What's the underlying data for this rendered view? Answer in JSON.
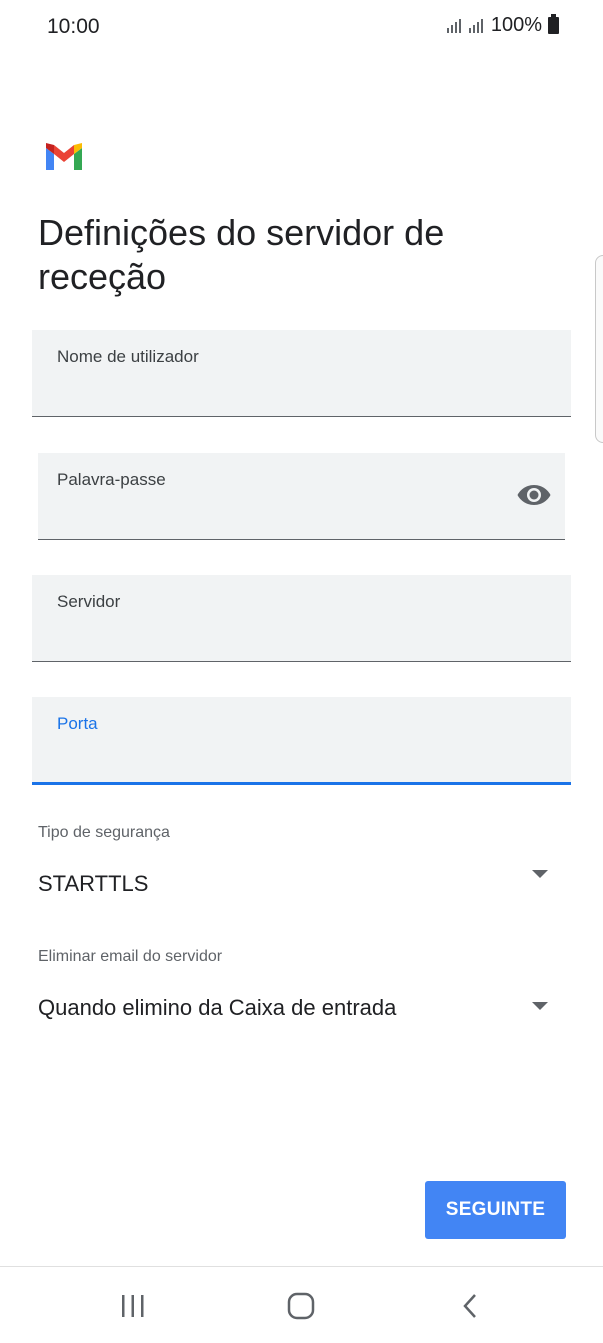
{
  "status_bar": {
    "time": "10:00",
    "battery": "100%",
    "icons": [
      "signal-icon",
      "signal-icon",
      "battery-icon"
    ]
  },
  "header": {
    "logo": "gmail-logo",
    "title": "Definições do servidor de receção"
  },
  "form": {
    "username": {
      "label": "Nome de utilizador",
      "value": ""
    },
    "password": {
      "label": "Palavra-passe",
      "value": "",
      "icon": "eye-icon"
    },
    "server": {
      "label": "Servidor",
      "value": ""
    },
    "port": {
      "label": "Porta",
      "value": ""
    }
  },
  "security": {
    "label": "Tipo de segurança",
    "value": "STARTTLS"
  },
  "delete_email": {
    "label": "Eliminar email do servidor",
    "value": "Quando elimino da Caixa de entrada"
  },
  "next_button": {
    "label": "SEGUINTE"
  },
  "nav": {
    "icons": [
      "recent-apps-icon",
      "home-icon",
      "back-icon"
    ]
  },
  "colors": {
    "accent": "#1a73e8",
    "button": "#4285f4",
    "field_bg": "#f1f3f4"
  }
}
